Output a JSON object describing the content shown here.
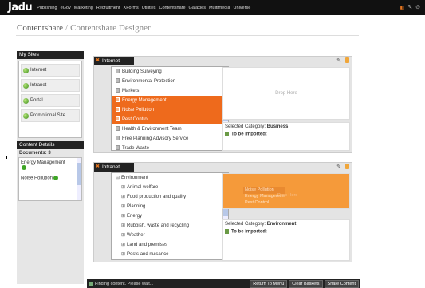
{
  "header": {
    "logo": "Jadu",
    "nav": [
      "Publishing",
      "eGov",
      "Marketing",
      "Recruitment",
      "XForms",
      "Utilities",
      "Contentshare",
      "Galaxies",
      "Multimedia",
      "Universe"
    ],
    "icons": [
      "user-icon",
      "settings-icon",
      "help-icon"
    ]
  },
  "breadcrumb": {
    "root": "Contentshare",
    "separator": "/",
    "page": "Contentshare Designer"
  },
  "sidebar": {
    "my_sites_title": "My Sites",
    "sites": [
      "Internet",
      "Intranet",
      "Portal",
      "Promotional Site"
    ],
    "content_details_title": "Content Details",
    "documents_label": "Documents: 3",
    "documents": [
      "Energy Management",
      "Noise Pollution"
    ]
  },
  "panels": [
    {
      "name": "Internet",
      "tree": [
        {
          "label": "Building Surveying",
          "selected": false
        },
        {
          "label": "Environmental Protection",
          "selected": false
        },
        {
          "label": "Markets",
          "selected": false
        },
        {
          "label": "Energy Management",
          "selected": true
        },
        {
          "label": "Noise Pollution",
          "selected": true
        },
        {
          "label": "Pest Control",
          "selected": true
        },
        {
          "label": "Health & Environment Team",
          "selected": false
        },
        {
          "label": "Free Planning Advisory Service",
          "selected": false
        },
        {
          "label": "Trade Waste",
          "selected": false
        }
      ],
      "drop_label": "Drop Here",
      "selected_category_label": "Selected Category:",
      "selected_category": "Business",
      "to_be_imported": "To be imported:"
    },
    {
      "name": "Intranet",
      "tree": [
        {
          "label": "Environment",
          "expander": "⊟"
        },
        {
          "label": "Animal welfare",
          "expander": "⊞"
        },
        {
          "label": "Food production and quality",
          "expander": "⊞"
        },
        {
          "label": "Planning",
          "expander": "⊞"
        },
        {
          "label": "Energy",
          "expander": "⊞"
        },
        {
          "label": "Rubbish, waste and recycling",
          "expander": "⊞"
        },
        {
          "label": "Weather",
          "expander": "⊞"
        },
        {
          "label": "Land and premises",
          "expander": "⊞"
        },
        {
          "label": "Pests and nuisance",
          "expander": "⊞"
        }
      ],
      "dragged": [
        "Noise Pollution",
        "Energy Management",
        "Pest Control"
      ],
      "drop_label": "Drop Here",
      "selected_category_label": "Selected Category:",
      "selected_category": "Environment",
      "to_be_imported": "To be imported:"
    }
  ],
  "footer": {
    "status": "Finding content. Please wait...",
    "buttons": [
      "Return To Menu",
      "Clear Baskets",
      "Share Content"
    ]
  },
  "colors": {
    "accent_orange": "#ee6a1c",
    "drop_orange": "#f59a3a",
    "bar_dark": "#222222"
  }
}
